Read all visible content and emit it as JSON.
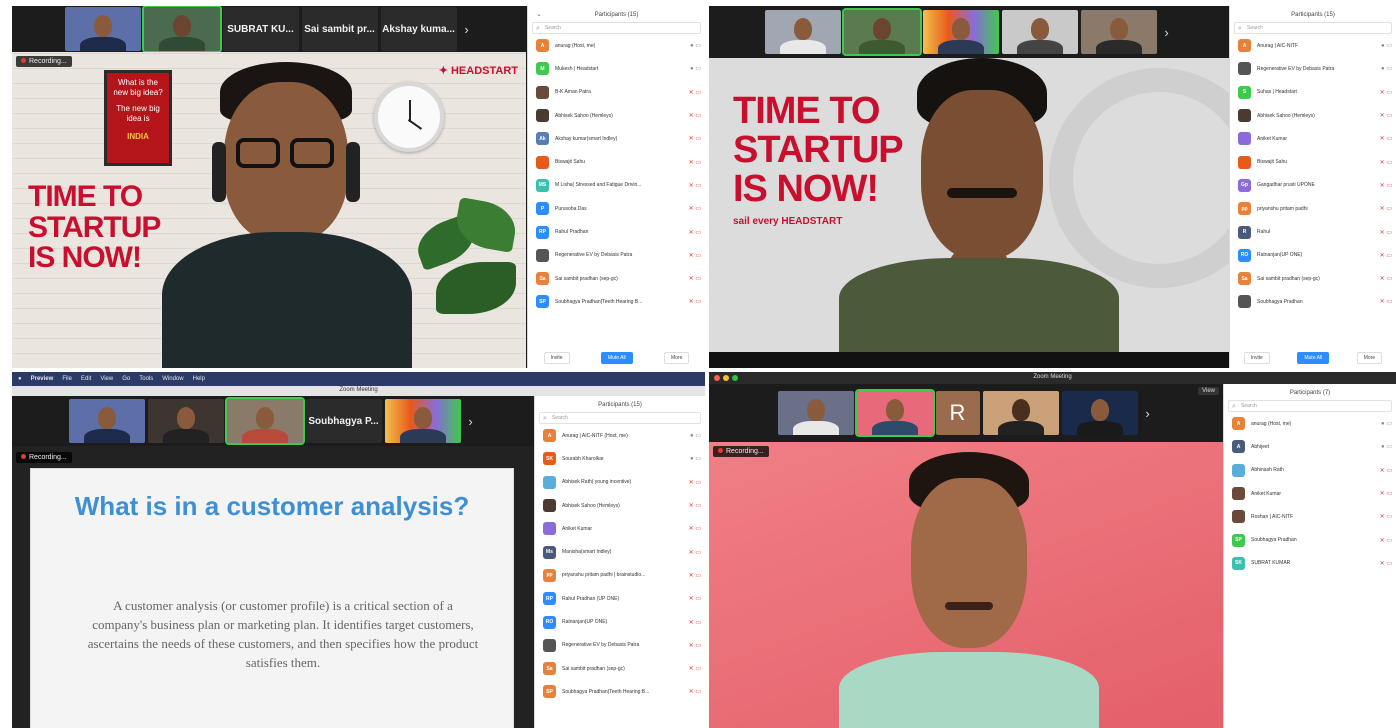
{
  "panel1": {
    "recording_label": "Recording...",
    "strip_names": [
      "SUBRAT KU...",
      "Sai sambit pr...",
      "Akshay kuma..."
    ],
    "poster": {
      "question": "What is the new big idea?",
      "answer": "The new big idea is",
      "country": "INDIA"
    },
    "brand": "HEADSTART",
    "slogan": [
      "TIME TO",
      "STARTUP",
      "IS NOW!"
    ],
    "participants_title": "Participants (15)",
    "search_placeholder": "Search",
    "participants": [
      {
        "initials": "A",
        "name": "anurag (Host, me)",
        "color": "#e8823a",
        "muted": false
      },
      {
        "initials": "M",
        "name": "Mukesh | Headstart",
        "color": "#3ec94f",
        "muted": false
      },
      {
        "initials": "",
        "name": "B-K Aman Patra",
        "color": "#6a4a3a",
        "muted": true
      },
      {
        "initials": "",
        "name": "Abhisek Sahoo (Hemleys)",
        "color": "#4a3a30",
        "muted": true
      },
      {
        "initials": "Ak",
        "name": "Akshay kumar(smart Indley)",
        "color": "#5a7db8",
        "muted": true
      },
      {
        "initials": "",
        "name": "Biswajit Sahu",
        "color": "#e85a1a",
        "muted": true
      },
      {
        "initials": "MS",
        "name": "M Lisha( Stressed and Fatigue Drivin...",
        "color": "#3cbfae",
        "muted": true
      },
      {
        "initials": "P",
        "name": "Purusoba Das",
        "color": "#2d8cff",
        "muted": true
      },
      {
        "initials": "RP",
        "name": "Rahul Pradhan",
        "color": "#2d8cff",
        "muted": true
      },
      {
        "initials": "",
        "name": "Regenerative EV by Debasis Patra",
        "color": "#555555",
        "muted": true
      },
      {
        "initials": "Sa",
        "name": "Sai sambit pradhan (sep-gc)",
        "color": "#e8823a",
        "muted": true
      },
      {
        "initials": "SP",
        "name": "Soubhagya Pradhan(Teeth Hearing B...",
        "color": "#2d8cff",
        "muted": true
      }
    ],
    "footer": {
      "invite": "Invite",
      "mute_all": "Mute All",
      "more": "More"
    }
  },
  "panel2": {
    "slogan": [
      "TIME TO",
      "STARTUP",
      "IS NOW!"
    ],
    "tagline": "sail every HEADSTART",
    "participants_title": "Participants (15)",
    "search_placeholder": "Search",
    "participants": [
      {
        "initials": "A",
        "name": "Anurag | AIC-NITF",
        "color": "#e8823a",
        "muted": false
      },
      {
        "initials": "",
        "name": "Regenerative EV by Debasis Patra",
        "color": "#555555",
        "muted": false
      },
      {
        "initials": "S",
        "name": "Suhas | Headstart",
        "color": "#3ec94f",
        "muted": true
      },
      {
        "initials": "",
        "name": "Abhisek Sahoo (Hemleys)",
        "color": "#4a3a30",
        "muted": true
      },
      {
        "initials": "",
        "name": "Aniket Kumar",
        "color": "#8b6bd9",
        "muted": true
      },
      {
        "initials": "",
        "name": "Biswajit Sahu",
        "color": "#e85a1a",
        "muted": true
      },
      {
        "initials": "Gp",
        "name": "Gangadhar prusti UPONE",
        "color": "#8b6bd9",
        "muted": true
      },
      {
        "initials": "pp",
        "name": "priyanshu pritam padhi",
        "color": "#e8823a",
        "muted": true
      },
      {
        "initials": "R",
        "name": "Rahul",
        "color": "#4a5a7a",
        "muted": true
      },
      {
        "initials": "RO",
        "name": "Ratnanjan(UP ONE)",
        "color": "#2d8cff",
        "muted": true
      },
      {
        "initials": "Sa",
        "name": "Sai sambit pradhan (sep-gc)",
        "color": "#e8823a",
        "muted": true
      },
      {
        "initials": "",
        "name": "Soubhagya Pradhan",
        "color": "#555555",
        "muted": true
      }
    ],
    "footer": {
      "invite": "Invite",
      "mute_all": "Mute All",
      "more": "More"
    }
  },
  "panel3": {
    "menubar": [
      "Preview",
      "File",
      "Edit",
      "View",
      "Go",
      "Tools",
      "Window",
      "Help"
    ],
    "window_title": "Zoom Meeting",
    "recording_label": "Recording...",
    "strip_names": [
      "Soubhagya P..."
    ],
    "slide_title": "What is in a customer analysis?",
    "slide_body": "A customer analysis (or customer profile) is a critical section of a company's business plan or marketing plan. It identifies target customers, ascertains the needs of these customers, and then specifies how the product satisfies them.",
    "participants_title": "Participants (15)",
    "search_placeholder": "Search",
    "participants": [
      {
        "initials": "A",
        "name": "Anurag | AIC-NITF (Host, me)",
        "color": "#e8823a",
        "muted": false
      },
      {
        "initials": "SK",
        "name": "Sourabh Kharolkar",
        "color": "#e85a1a",
        "muted": false
      },
      {
        "initials": "",
        "name": "Abhisek Rath( young incentive)",
        "color": "#5aaed9",
        "muted": true
      },
      {
        "initials": "",
        "name": "Abhisek Sahoo (Hemleys)",
        "color": "#4a3a30",
        "muted": true
      },
      {
        "initials": "",
        "name": "Aniket Kumar",
        "color": "#8b6bd9",
        "muted": true
      },
      {
        "initials": "Ms",
        "name": "Manisha(smart Indley)",
        "color": "#4a5a7a",
        "muted": true
      },
      {
        "initials": "pp",
        "name": "priyanshu pritam padhi | brainstudio...",
        "color": "#e8823a",
        "muted": true
      },
      {
        "initials": "RP",
        "name": "Rahul Pradhan (UP ONE)",
        "color": "#2d8cff",
        "muted": true
      },
      {
        "initials": "RO",
        "name": "Ratnanjan(UP ONE)",
        "color": "#2d8cff",
        "muted": true
      },
      {
        "initials": "",
        "name": "Regenerative EV by Debasis Patra",
        "color": "#555555",
        "muted": true
      },
      {
        "initials": "Sa",
        "name": "Sai sambit pradhan (sep-gc)",
        "color": "#e8823a",
        "muted": true
      },
      {
        "initials": "SP",
        "name": "Soubhagya Pradhan(Teeth Hearing B...",
        "color": "#e8823a",
        "muted": true
      }
    ]
  },
  "panel4": {
    "window_title": "Zoom Meeting",
    "recording_label": "Recording...",
    "strip_letter": "R",
    "view_label": "View",
    "participants_title": "Participants (7)",
    "search_placeholder": "Search",
    "participants": [
      {
        "initials": "A",
        "name": "anurag (Host, me)",
        "color": "#e8823a",
        "muted": false
      },
      {
        "initials": "A",
        "name": "Abhijeet",
        "color": "#4a5a7a",
        "muted": false
      },
      {
        "initials": "",
        "name": "Abhinash Rath",
        "color": "#5aaed9",
        "muted": true
      },
      {
        "initials": "",
        "name": "Aniket Kumar",
        "color": "#6a4a3a",
        "muted": true
      },
      {
        "initials": "",
        "name": "Roshan | AIC-NITF",
        "color": "#6a4a3a",
        "muted": true
      },
      {
        "initials": "SP",
        "name": "Soubhagya Pradhan",
        "color": "#3ec94f",
        "muted": true
      },
      {
        "initials": "SK",
        "name": "SUBRAT KUMAR",
        "color": "#3cbfae",
        "muted": true
      }
    ]
  }
}
